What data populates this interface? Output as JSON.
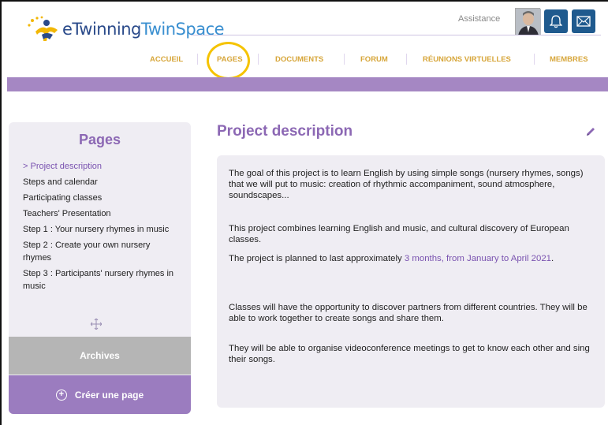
{
  "header": {
    "logo_text_1": "eTwinning",
    "logo_text_2": "TwinSpace",
    "assistance": "Assistance",
    "icons": [
      "bell-icon",
      "mail-icon"
    ],
    "nav": [
      "ACCUEIL",
      "PAGES",
      "DOCUMENTS",
      "FORUM",
      "RÉUNIONS VIRTUELLES",
      "MEMBRES"
    ]
  },
  "sidebar": {
    "title": "Pages",
    "items": [
      "> Project description",
      "Steps and calendar",
      "Participating classes",
      "Teachers' Presentation",
      "Step 1 : Your nursery rhymes in music",
      "Step 2 : Create your own nursery rhymes",
      "Step 3 : Participants' nursery rhymes in music"
    ],
    "archives": "Archives",
    "create_page": "Créer une page"
  },
  "main": {
    "title": "Project description",
    "p1": "The goal of this project is to learn English by using simple songs (nursery rhymes, songs) that we will put to music: creation of rhythmic accompaniment, sound atmosphere, soundscapes...",
    "p2": "This project combines learning English and music, and cultural discovery of European classes.",
    "p3_pre": "The project is planned to last approximately ",
    "p3_hl": "3 months, from January to April 2021",
    "p3_post": ".",
    "p4": "Classes will have the opportunity to discover partners from different countries. They will be able to work together to create songs and share them.",
    "p5": "They will be able to organise videoconference meetings to get to know each other and sing their songs."
  },
  "colors": {
    "accent_purple": "#8c68b4",
    "band_purple": "#a587c3",
    "nav_gold": "#d7a63a",
    "icon_blue": "#1f5a8e",
    "highlight_yellow": "#f5c300"
  }
}
